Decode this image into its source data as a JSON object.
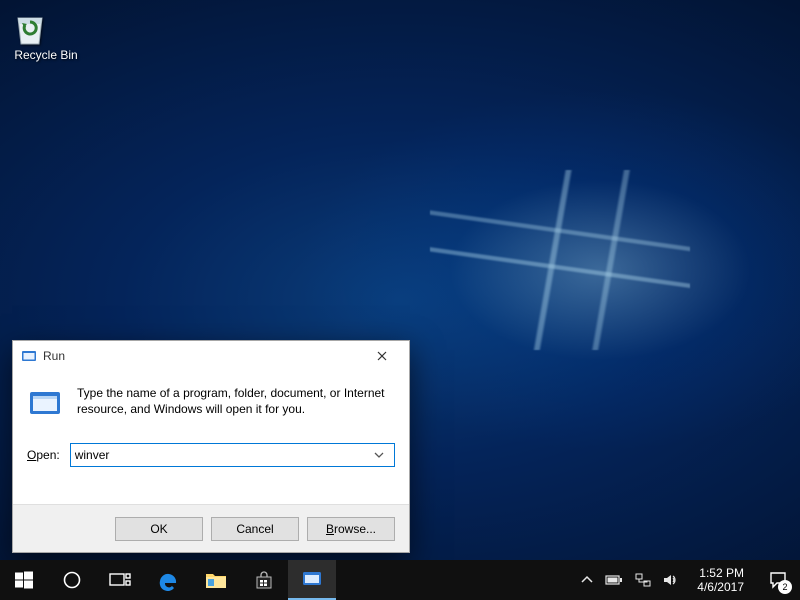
{
  "desktop": {
    "recycle_bin_label": "Recycle Bin"
  },
  "run": {
    "title": "Run",
    "message": "Type the name of a program, folder, document, or Internet resource, and Windows will open it for you.",
    "open_label_pre": "O",
    "open_label_post": "pen:",
    "value": "winver",
    "ok": "OK",
    "cancel": "Cancel",
    "browse": "Browse..."
  },
  "taskbar": {
    "time": "1:52 PM",
    "date": "4/6/2017",
    "notification_count": "2"
  }
}
